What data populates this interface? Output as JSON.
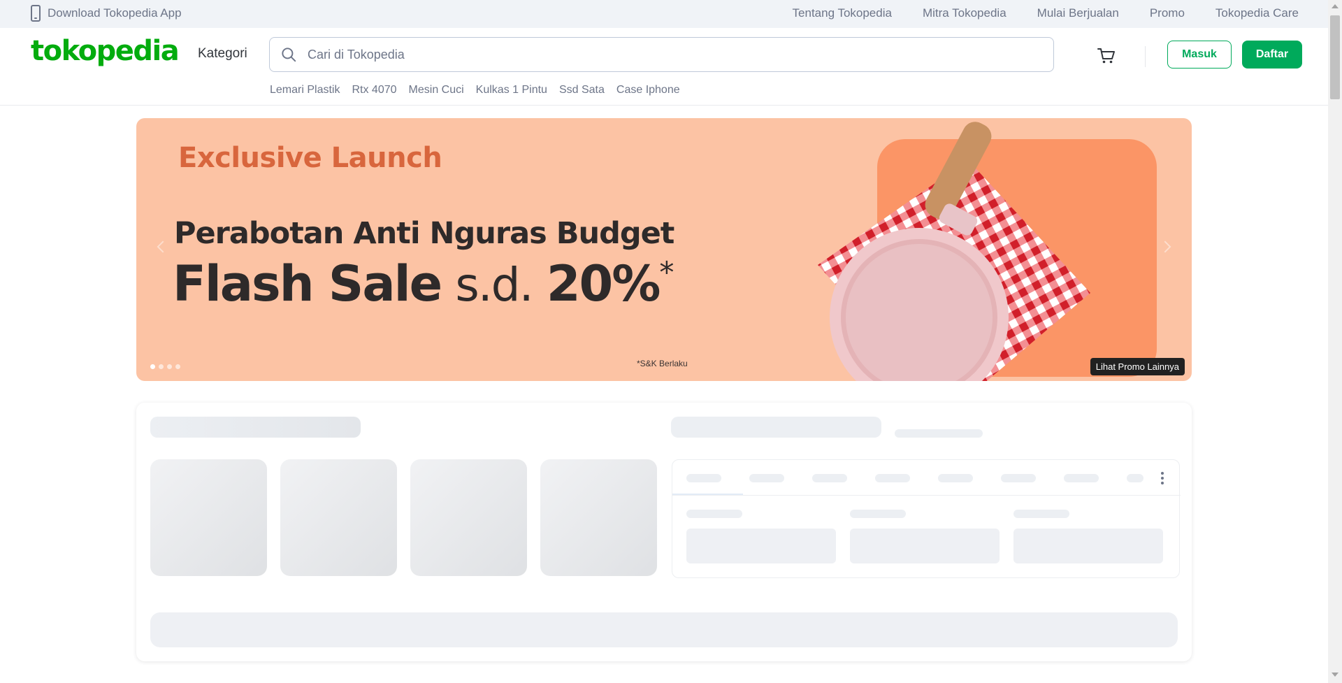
{
  "topbar": {
    "download_app": "Download Tokopedia App",
    "links": [
      "Tentang Tokopedia",
      "Mitra Tokopedia",
      "Mulai Berjualan",
      "Promo",
      "Tokopedia Care"
    ]
  },
  "header": {
    "logo": "tokopedia",
    "kategori": "Kategori",
    "search_placeholder": "Cari di Tokopedia",
    "suggestions": [
      "Lemari Plastik",
      "Rtx 4070",
      "Mesin Cuci",
      "Kulkas 1 Pintu",
      "Ssd Sata",
      "Case Iphone"
    ],
    "login_label": "Masuk",
    "register_label": "Daftar"
  },
  "banner": {
    "eyebrow": "Exclusive Launch",
    "headline": "Perabotan Anti Nguras Budget",
    "flash_a": "Flash Sale",
    "flash_b": "s.d.",
    "flash_c": "20%",
    "flash_mark": "*",
    "terms": "*S&K Berlaku",
    "promo_button": "Lihat Promo Lainnya",
    "slide_count": 4,
    "active_slide": 1
  },
  "icons": {
    "app": "phone-icon",
    "search": "search-icon",
    "cart": "cart-icon",
    "menu": "more-vertical-icon"
  },
  "colors": {
    "brand": "#03ac0e",
    "primary_button": "#00aa5b",
    "banner_bg": "#fcc3a4",
    "banner_accent": "#d8663d",
    "topbar_bg": "#f0f3f7"
  }
}
